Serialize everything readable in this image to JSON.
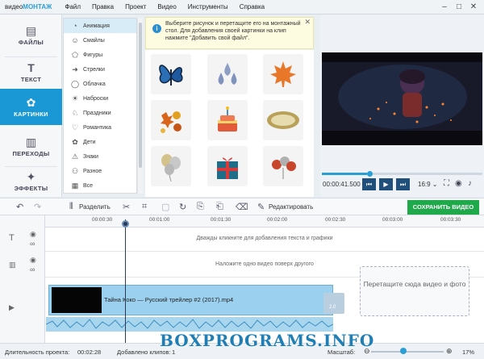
{
  "app": {
    "brand_prefix": "видео",
    "brand_suffix": "МОНТАЖ",
    "menu": [
      "Файл",
      "Правка",
      "Проект",
      "Видео",
      "Инструменты",
      "Справка"
    ]
  },
  "sidebar": {
    "items": [
      {
        "label": "ФАЙЛЫ",
        "icon": "files-icon"
      },
      {
        "label": "ТЕКСТ",
        "icon": "text-icon"
      },
      {
        "label": "КАРТИНКИ",
        "icon": "pictures-icon",
        "active": true
      },
      {
        "label": "ПЕРЕХОДЫ",
        "icon": "transitions-icon"
      },
      {
        "label": "ЭФФЕКТЫ",
        "icon": "effects-icon"
      }
    ]
  },
  "categories": {
    "items": [
      {
        "label": "Анимация",
        "icon": "animation-icon",
        "selected": true
      },
      {
        "label": "Смайлы",
        "icon": "smiley-icon"
      },
      {
        "label": "Фигуры",
        "icon": "shapes-icon"
      },
      {
        "label": "Стрелки",
        "icon": "arrows-icon"
      },
      {
        "label": "Облачка",
        "icon": "speech-bubble-icon"
      },
      {
        "label": "Наброски",
        "icon": "sketch-icon"
      },
      {
        "label": "Праздники",
        "icon": "holiday-icon"
      },
      {
        "label": "Романтика",
        "icon": "heart-icon"
      },
      {
        "label": "Дети",
        "icon": "kids-icon"
      },
      {
        "label": "Знаки",
        "icon": "signs-icon"
      },
      {
        "label": "Разное",
        "icon": "misc-icon"
      },
      {
        "label": "Все",
        "icon": "all-icon"
      }
    ]
  },
  "banner": {
    "text": "Выберите рисунок и перетащите его на монтажный стол. Для добавления своей картинки на клип нажмите \"Добавить свой файл\"."
  },
  "stickers": [
    "butterfly-icon",
    "drops-icon",
    "maple-leaf-icon",
    "autumn-leaves-icon",
    "birthday-cake-icon",
    "plaque-icon",
    "balloons-icon",
    "gift-box-icon",
    "ribbon-balloons-icon"
  ],
  "player": {
    "timecode": "00:00:41.500",
    "ratio": "16:9 ⌄",
    "progress": 0.28
  },
  "toolbar": {
    "split_label": "Разделить",
    "edit_label": "Редактировать",
    "save_label": "СОХРАНИТЬ ВИДЕО"
  },
  "timeline": {
    "ticks": [
      "00:00:30",
      "00:01:00",
      "00:01:30",
      "00:02:00",
      "00:02:30",
      "00:03:00",
      "00:03:30"
    ],
    "text_track_hint": "Дважды кликните для добавления текста и графики",
    "overlay_track_hint": "Наложите одно видео поверх другого",
    "clip_name": "Тайна Коко — Русский трейлер #2 (2017).mp4",
    "slot_label": "2.0",
    "drop_zone_text": "Перетащите сюда видео и фото"
  },
  "status": {
    "duration_label": "Длительность проекта:",
    "duration_value": "00:02:28",
    "clips_label": "Добавлено клипов:",
    "clips_value": "1",
    "zoom_label": "Масштаб:",
    "zoom_value": "17%",
    "zoom_fraction": 0.4
  },
  "watermark": "BOXPROGRAMS.INFO"
}
